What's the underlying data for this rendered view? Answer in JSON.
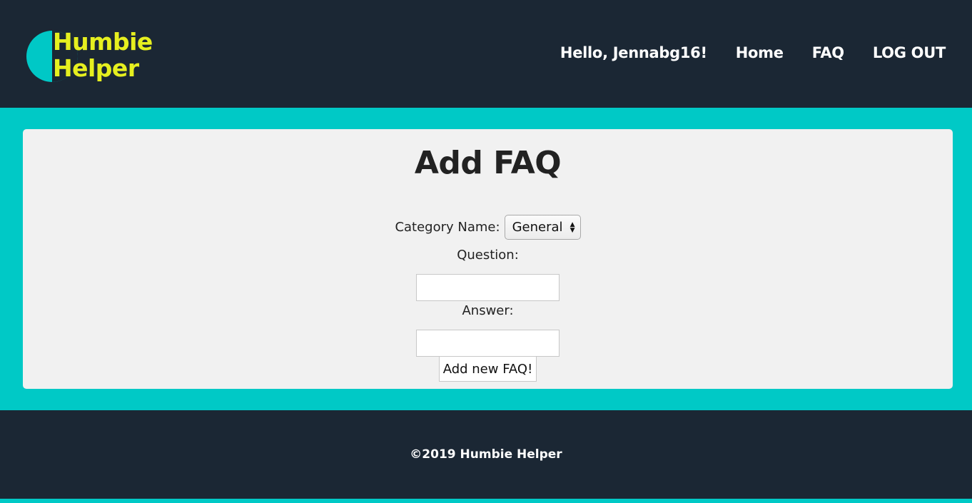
{
  "brand": {
    "line1": "Humbie",
    "line2": "Helper",
    "colors": {
      "dark": "#1b2734",
      "teal": "#00c9c6",
      "yellow": "#e6ef1f"
    }
  },
  "nav": {
    "greeting": "Hello, Jennabg16!",
    "home": "Home",
    "faq": "FAQ",
    "logout": "LOG OUT"
  },
  "form": {
    "title": "Add FAQ",
    "category_label": "Category Name:",
    "category_selected": "General",
    "question_label": "Question:",
    "question_value": "",
    "answer_label": "Answer:",
    "answer_value": "",
    "submit_label": "Add new FAQ!"
  },
  "footer": {
    "copyright": "©2019 Humbie Helper"
  }
}
